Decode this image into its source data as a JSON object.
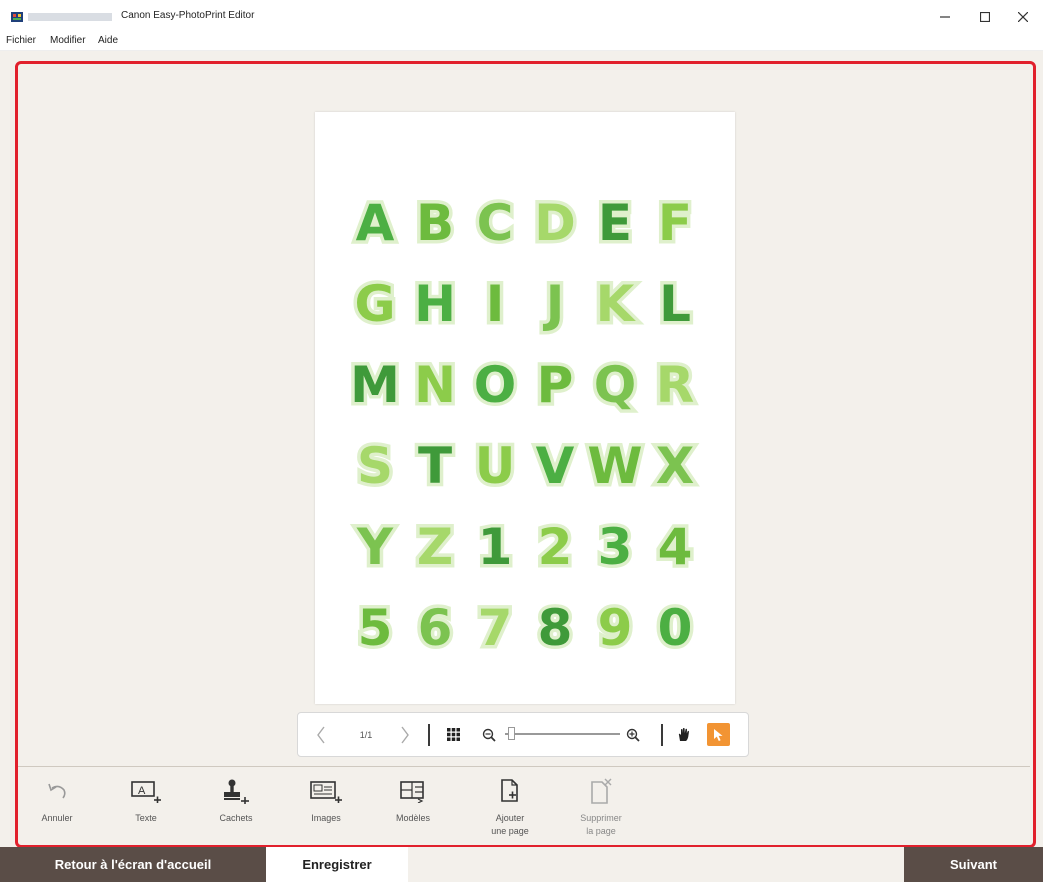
{
  "window": {
    "title": "Canon Easy-PhotoPrint Editor",
    "controls": [
      "minimize-icon",
      "maximize-icon",
      "close-icon"
    ]
  },
  "menu": [
    "Fichier",
    "Modifier",
    "Aide"
  ],
  "canvas": {
    "glyphs": [
      "A",
      "B",
      "C",
      "D",
      "E",
      "F",
      "G",
      "H",
      "I",
      "J",
      "K",
      "L",
      "M",
      "N",
      "O",
      "P",
      "Q",
      "R",
      "S",
      "T",
      "U",
      "V",
      "W",
      "X",
      "Y",
      "Z",
      "1",
      "2",
      "3",
      "4",
      "5",
      "6",
      "7",
      "8",
      "9",
      "0"
    ],
    "glyph_colors": [
      "#4caf43",
      "#8ccc4a",
      "#3f9a3a",
      "#a6d86a",
      "#7cc350",
      "#6dbb3e"
    ]
  },
  "pagebar": {
    "page_indicator": "1/1",
    "icons": [
      "chevron-left-icon",
      "chevron-right-icon",
      "grid-view-icon",
      "zoom-out-icon",
      "zoom-in-icon",
      "hand-tool-icon",
      "pointer-tool-icon"
    ],
    "zoom_level_fraction": 0.03,
    "accent": "#f29433"
  },
  "tools": [
    {
      "id": "undo",
      "label": "Annuler",
      "icon": "undo-icon"
    },
    {
      "id": "text",
      "label": "Texte",
      "icon": "add-text-icon"
    },
    {
      "id": "stamps",
      "label": "Cachets",
      "icon": "add-stamp-icon"
    },
    {
      "id": "images",
      "label": "Images",
      "icon": "add-image-icon"
    },
    {
      "id": "templates",
      "label": "Modèles",
      "icon": "templates-icon"
    },
    {
      "id": "add_page",
      "label": "Ajouter\nune page",
      "icon": "add-page-icon"
    },
    {
      "id": "delete_page",
      "label": "Supprimer\nla page",
      "icon": "delete-page-icon"
    }
  ],
  "footer": {
    "home": "Retour à l'écran d'accueil",
    "save": "Enregistrer",
    "next": "Suivant",
    "color": "#5a4d47"
  },
  "highlight_color": "#e1202c"
}
